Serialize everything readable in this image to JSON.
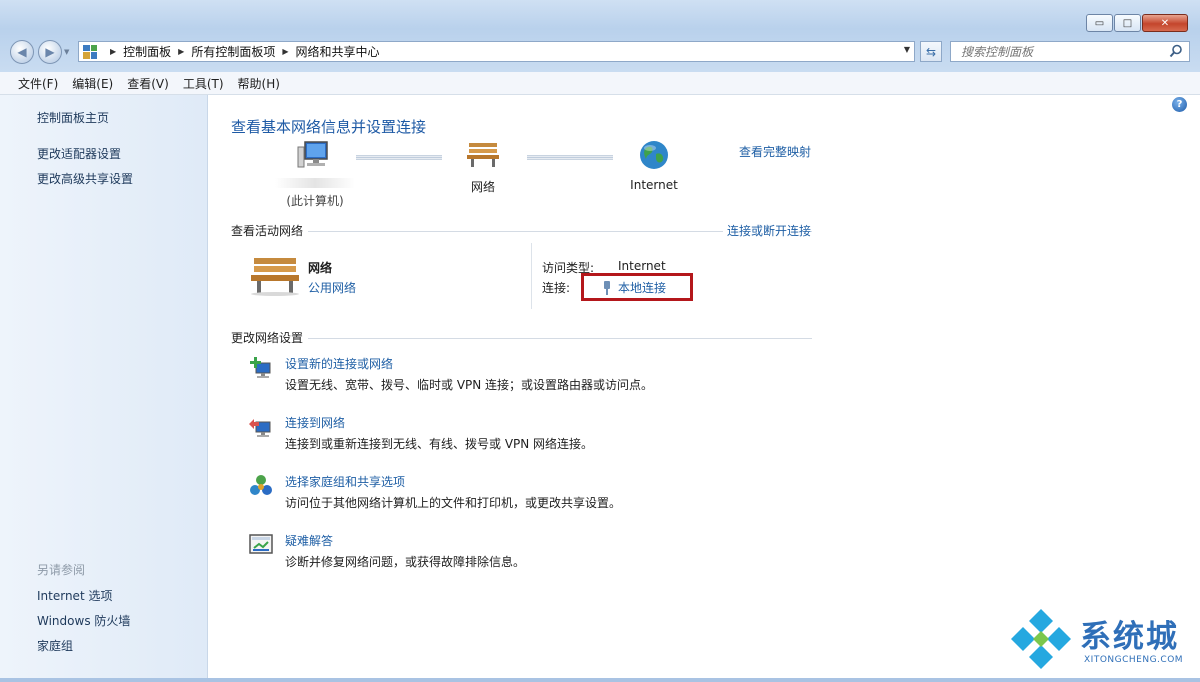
{
  "window": {
    "caption_buttons": {
      "minimize": "▭",
      "maximize": "□",
      "close": "✕"
    },
    "breadcrumb": [
      "控制面板",
      "所有控制面板项",
      "网络和共享中心"
    ],
    "search_placeholder": "搜索控制面板"
  },
  "menu": [
    "文件(F)",
    "编辑(E)",
    "查看(V)",
    "工具(T)",
    "帮助(H)"
  ],
  "sidebar": {
    "links": [
      "控制面板主页",
      "更改适配器设置",
      "更改高级共享设置"
    ],
    "see_also_heading": "另请参阅",
    "see_also": [
      "Internet 选项",
      "Windows 防火墙",
      "家庭组"
    ]
  },
  "main": {
    "title": "查看基本网络信息并设置连接",
    "full_map_link": "查看完整映射",
    "map": {
      "computer_label": "(此计算机)",
      "network_label": "网络",
      "internet_label": "Internet"
    },
    "active_networks": {
      "heading": "查看活动网络",
      "connect_link": "连接或断开连接",
      "network_name": "网络",
      "network_type": "公用网络",
      "access_type_label": "访问类型:",
      "access_type_value": "Internet",
      "connections_label": "连接:",
      "connection_value": "本地连接"
    },
    "change_settings": {
      "heading": "更改网络设置",
      "tasks": [
        {
          "icon": "new-connection-icon",
          "link": "设置新的连接或网络",
          "desc": "设置无线、宽带、拨号、临时或 VPN 连接；或设置路由器或访问点。"
        },
        {
          "icon": "connect-network-icon",
          "link": "连接到网络",
          "desc": "连接到或重新连接到无线、有线、拨号或 VPN 网络连接。"
        },
        {
          "icon": "homegroup-icon",
          "link": "选择家庭组和共享选项",
          "desc": "访问位于其他网络计算机上的文件和打印机，或更改共享设置。"
        },
        {
          "icon": "troubleshoot-icon",
          "link": "疑难解答",
          "desc": "诊断并修复网络问题，或获得故障排除信息。"
        }
      ]
    }
  },
  "watermark": {
    "brand": "系统城",
    "url": "XITONGCHENG.COM"
  },
  "colors": {
    "link": "#1f5fa5",
    "title": "#1e5aa5",
    "highlight_box": "#b4171b",
    "sidebar": "#dfeaf7"
  }
}
